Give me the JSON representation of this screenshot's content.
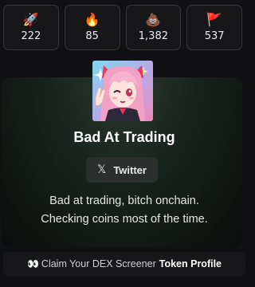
{
  "stats": [
    {
      "icon": "rocket-icon",
      "emoji": "🚀",
      "value": "222"
    },
    {
      "icon": "fire-icon",
      "emoji": "🔥",
      "value": "85"
    },
    {
      "icon": "poop-icon",
      "emoji": "💩",
      "value": "1,382"
    },
    {
      "icon": "red-flag-icon",
      "emoji": "🚩",
      "value": "537"
    }
  ],
  "profile": {
    "title": "Bad At Trading",
    "twitter_label": "Twitter",
    "twitter_icon": "x-logo-icon",
    "description_line1": "Bad at trading, bitch onchain.",
    "description_line2": "Checking coins most of the time."
  },
  "claim": {
    "icon": "eyes-icon",
    "emoji": "👀",
    "text": "Claim Your DEX Screener",
    "bold_text": "Token Profile"
  },
  "colors": {
    "background": "#111114",
    "card_top": "#283a2f",
    "button_bg": "#2b2f2d"
  }
}
